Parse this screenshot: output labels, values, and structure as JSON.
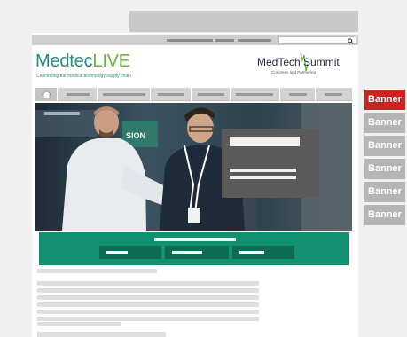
{
  "header": {
    "medtec_logo": {
      "part1": "Medtec",
      "part2": "LIVE",
      "tagline": "Connecting the medical technology supply chain"
    },
    "summit_logo": {
      "name": "MedTech Summit",
      "subtitle": "Congress and Partnering"
    }
  },
  "side_banners": [
    "Banner",
    "Banner",
    "Banner",
    "Banner",
    "Banner",
    "Banner"
  ],
  "colors": {
    "brand_teal": "#2a8c7a",
    "brand_green": "#6db33f",
    "cta_green": "#13906f",
    "banner_active": "#cc2222",
    "banner_inactive": "#b5b5b5"
  },
  "icons": {
    "search": "magnifier-icon",
    "home": "house-icon"
  }
}
